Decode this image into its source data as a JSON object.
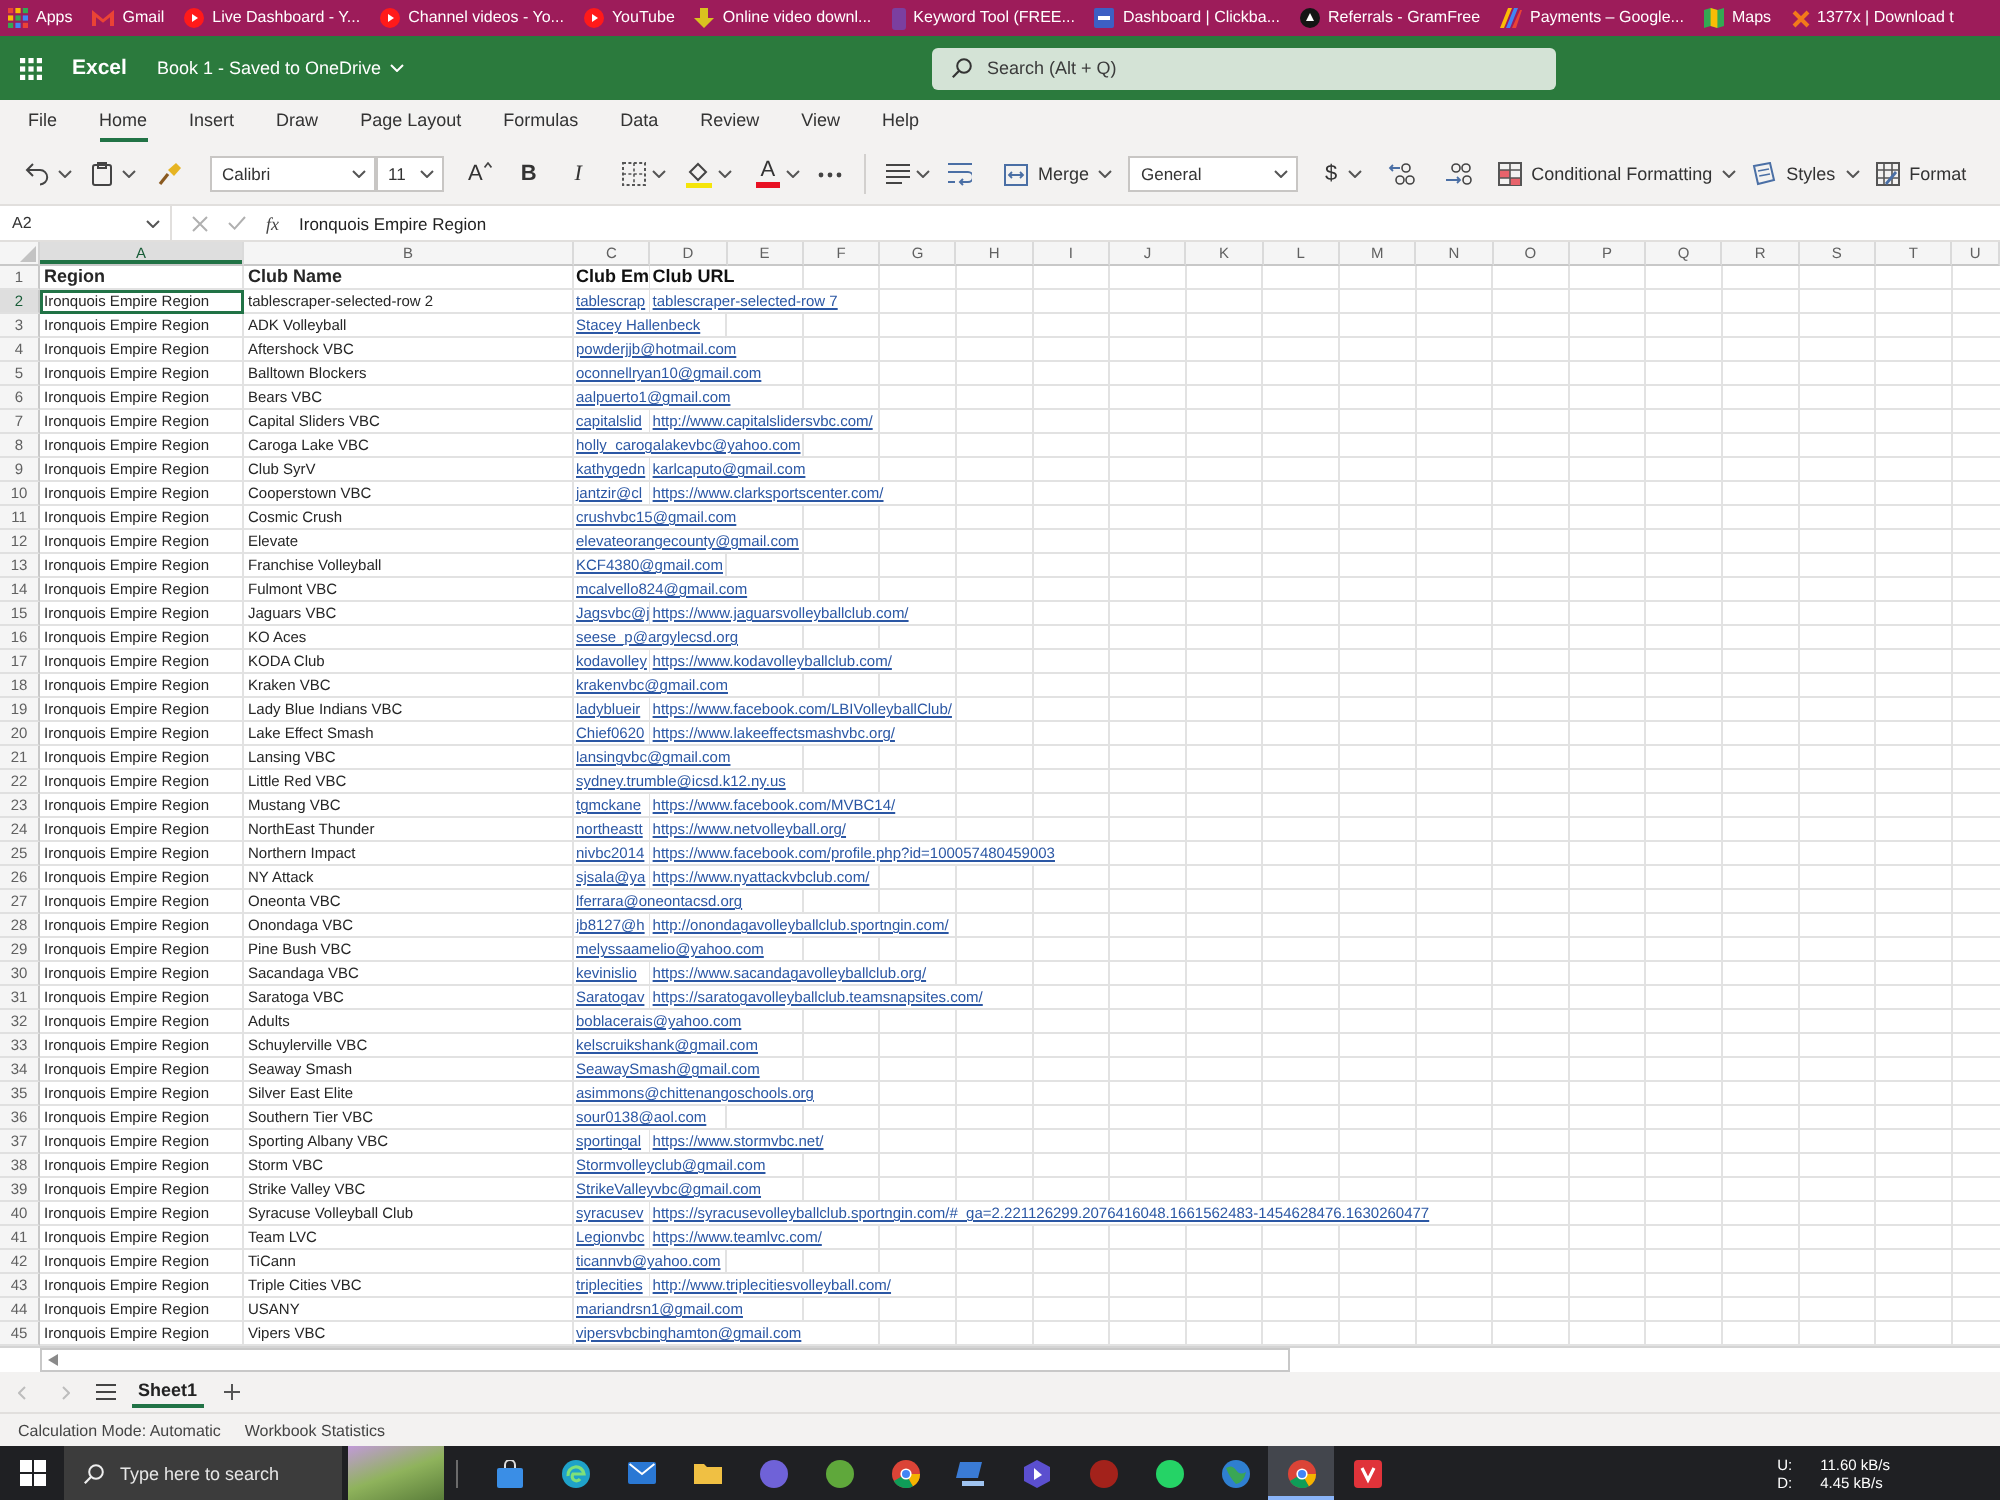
{
  "bookmarks_bar": {
    "items": [
      {
        "label": "Apps",
        "kind": "apps"
      },
      {
        "label": "Gmail",
        "kind": "mail"
      },
      {
        "label": "Live Dashboard - Y...",
        "kind": "video"
      },
      {
        "label": "Channel videos - Yo...",
        "kind": "video"
      },
      {
        "label": "YouTube",
        "kind": "video"
      },
      {
        "label": "Online video downl...",
        "kind": "download"
      },
      {
        "label": "Keyword Tool (FREE...",
        "kind": "tile"
      },
      {
        "label": "Dashboard | Clickba...",
        "kind": "square"
      },
      {
        "label": "Referrals - GramFree",
        "kind": "circle"
      },
      {
        "label": "Payments – Google...",
        "kind": "stripes"
      },
      {
        "label": "Maps",
        "kind": "map"
      },
      {
        "label": "1377x | Download t",
        "kind": "cross"
      }
    ]
  },
  "app_header": {
    "app_name": "Excel",
    "document_title": "Book 1 - Saved to OneDrive",
    "search": {
      "placeholder": "Search (Alt + Q)"
    }
  },
  "menu_tabs": [
    {
      "label": "File",
      "selected": false
    },
    {
      "label": "Home",
      "selected": true
    },
    {
      "label": "Insert",
      "selected": false
    },
    {
      "label": "Draw",
      "selected": false
    },
    {
      "label": "Page Layout",
      "selected": false
    },
    {
      "label": "Formulas",
      "selected": false
    },
    {
      "label": "Data",
      "selected": false
    },
    {
      "label": "Review",
      "selected": false
    },
    {
      "label": "View",
      "selected": false
    },
    {
      "label": "Help",
      "selected": false
    }
  ],
  "ribbon": {
    "font_name": "Calibri",
    "font_size": "11",
    "increase_font": "A",
    "bold": "B",
    "italic": "I",
    "font_color": "A",
    "merge": "Merge",
    "number_format": "General",
    "currency": "$",
    "conditional_formatting": "Conditional Formatting",
    "styles": "Styles",
    "format": "Format"
  },
  "formula_bar": {
    "name_box": "A2",
    "function_label": "fx",
    "formula": "Ironquois Empire Region"
  },
  "sheet": {
    "columns": [
      {
        "label": "A",
        "selected": true
      },
      {
        "label": "B",
        "selected": false
      },
      {
        "label": "C",
        "selected": false
      },
      {
        "label": "D",
        "selected": false
      },
      {
        "label": "E",
        "selected": false
      },
      {
        "label": "F",
        "selected": false
      },
      {
        "label": "G",
        "selected": false
      },
      {
        "label": "H",
        "selected": false
      },
      {
        "label": "I",
        "selected": false
      },
      {
        "label": "J",
        "selected": false
      },
      {
        "label": "K",
        "selected": false
      },
      {
        "label": "L",
        "selected": false
      },
      {
        "label": "M",
        "selected": false
      },
      {
        "label": "N",
        "selected": false
      },
      {
        "label": "O",
        "selected": false
      },
      {
        "label": "P",
        "selected": false
      },
      {
        "label": "Q",
        "selected": false
      },
      {
        "label": "R",
        "selected": false
      },
      {
        "label": "S",
        "selected": false
      },
      {
        "label": "T",
        "selected": false
      },
      {
        "label": "U",
        "selected": false
      }
    ],
    "rows": [
      {
        "number": "1",
        "kind": "header",
        "selected": false,
        "cells": {
          "A": "Region",
          "B": "Club Name",
          "C": "Club Em",
          "D": "Club URL"
        }
      },
      {
        "number": "2",
        "kind": "data",
        "selected": true,
        "cells": {
          "A": "Ironquois Empire Region",
          "B": "tablescraper-selected-row 2",
          "C": "tablescrap",
          "D": "tablescraper-selected-row 7"
        }
      },
      {
        "number": "3",
        "kind": "data",
        "selected": false,
        "cells": {
          "A": "Ironquois Empire Region",
          "B": "ADK Volleyball",
          "C": "Stacey Hallenbeck"
        }
      },
      {
        "number": "4",
        "kind": "data",
        "selected": false,
        "cells": {
          "A": "Ironquois Empire Region",
          "B": "Aftershock VBC",
          "C": "powderjjb@hotmail.com"
        }
      },
      {
        "number": "5",
        "kind": "data",
        "selected": false,
        "cells": {
          "A": "Ironquois Empire Region",
          "B": "Balltown Blockers",
          "C": "oconnellryan10@gmail.com"
        }
      },
      {
        "number": "6",
        "kind": "data",
        "selected": false,
        "cells": {
          "A": "Ironquois Empire Region",
          "B": "Bears VBC",
          "C": "aalpuerto1@gmail.com"
        }
      },
      {
        "number": "7",
        "kind": "data",
        "selected": false,
        "cells": {
          "A": "Ironquois Empire Region",
          "B": "Capital Sliders VBC",
          "C": "capitalslid",
          "D": "http://www.capitalslidersvbc.com/"
        }
      },
      {
        "number": "8",
        "kind": "data",
        "selected": false,
        "cells": {
          "A": "Ironquois Empire Region",
          "B": "Caroga Lake VBC",
          "C": "holly_carogalakevbc@yahoo.com"
        }
      },
      {
        "number": "9",
        "kind": "data",
        "selected": false,
        "cells": {
          "A": "Ironquois Empire Region",
          "B": "Club SyrV",
          "C": "kathygedn",
          "D": "karlcaputo@gmail.com"
        }
      },
      {
        "number": "10",
        "kind": "data",
        "selected": false,
        "cells": {
          "A": "Ironquois Empire Region",
          "B": "Cooperstown VBC",
          "C": "jantzir@cl",
          "D": "https://www.clarksportscenter.com/"
        }
      },
      {
        "number": "11",
        "kind": "data",
        "selected": false,
        "cells": {
          "A": "Ironquois Empire Region",
          "B": "Cosmic Crush",
          "C": "crushvbc15@gmail.com"
        }
      },
      {
        "number": "12",
        "kind": "data",
        "selected": false,
        "cells": {
          "A": "Ironquois Empire Region",
          "B": "Elevate",
          "C": "elevateorangecounty@gmail.com"
        }
      },
      {
        "number": "13",
        "kind": "data",
        "selected": false,
        "cells": {
          "A": "Ironquois Empire Region",
          "B": "Franchise Volleyball",
          "C": "KCF4380@gmail.com"
        }
      },
      {
        "number": "14",
        "kind": "data",
        "selected": false,
        "cells": {
          "A": "Ironquois Empire Region",
          "B": "Fulmont VBC",
          "C": "mcalvello824@gmail.com"
        }
      },
      {
        "number": "15",
        "kind": "data",
        "selected": false,
        "cells": {
          "A": "Ironquois Empire Region",
          "B": "Jaguars VBC",
          "C": "Jagsvbc@j",
          "D": "https://www.jaguarsvolleyballclub.com/"
        }
      },
      {
        "number": "16",
        "kind": "data",
        "selected": false,
        "cells": {
          "A": "Ironquois Empire Region",
          "B": "KO Aces",
          "C": "seese_p@argylecsd.org"
        }
      },
      {
        "number": "17",
        "kind": "data",
        "selected": false,
        "cells": {
          "A": "Ironquois Empire Region",
          "B": "KODA Club",
          "C": "kodavolley",
          "D": "https://www.kodavolleyballclub.com/"
        }
      },
      {
        "number": "18",
        "kind": "data",
        "selected": false,
        "cells": {
          "A": "Ironquois Empire Region",
          "B": "Kraken VBC",
          "C": "krakenvbc@gmail.com"
        }
      },
      {
        "number": "19",
        "kind": "data",
        "selected": false,
        "cells": {
          "A": "Ironquois Empire Region",
          "B": "Lady Blue Indians VBC",
          "C": "ladyblueir",
          "D": "https://www.facebook.com/LBIVolleyballClub/"
        }
      },
      {
        "number": "20",
        "kind": "data",
        "selected": false,
        "cells": {
          "A": "Ironquois Empire Region",
          "B": "Lake Effect Smash",
          "C": "Chief0620",
          "D": "https://www.lakeeffectsmashvbc.org/"
        }
      },
      {
        "number": "21",
        "kind": "data",
        "selected": false,
        "cells": {
          "A": "Ironquois Empire Region",
          "B": "Lansing VBC",
          "C": "lansingvbc@gmail.com"
        }
      },
      {
        "number": "22",
        "kind": "data",
        "selected": false,
        "cells": {
          "A": "Ironquois Empire Region",
          "B": "Little Red VBC",
          "C": "sydney.trumble@icsd.k12.ny.us"
        }
      },
      {
        "number": "23",
        "kind": "data",
        "selected": false,
        "cells": {
          "A": "Ironquois Empire Region",
          "B": "Mustang VBC",
          "C": "tgmckane",
          "D": "https://www.facebook.com/MVBC14/"
        }
      },
      {
        "number": "24",
        "kind": "data",
        "selected": false,
        "cells": {
          "A": "Ironquois Empire Region",
          "B": "NorthEast Thunder",
          "C": "northeastt",
          "D": "https://www.netvolleyball.org/"
        }
      },
      {
        "number": "25",
        "kind": "data",
        "selected": false,
        "cells": {
          "A": "Ironquois Empire Region",
          "B": "Northern Impact",
          "C": "nivbc2014",
          "D": "https://www.facebook.com/profile.php?id=100057480459003"
        }
      },
      {
        "number": "26",
        "kind": "data",
        "selected": false,
        "cells": {
          "A": "Ironquois Empire Region",
          "B": "NY Attack",
          "C": "sjsala@ya",
          "D": "https://www.nyattackvbclub.com/"
        }
      },
      {
        "number": "27",
        "kind": "data",
        "selected": false,
        "cells": {
          "A": "Ironquois Empire Region",
          "B": "Oneonta VBC",
          "C": "lferrara@oneontacsd.org"
        }
      },
      {
        "number": "28",
        "kind": "data",
        "selected": false,
        "cells": {
          "A": "Ironquois Empire Region",
          "B": "Onondaga VBC",
          "C": "jb8127@h",
          "D": "http://onondagavolleyballclub.sportngin.com/"
        }
      },
      {
        "number": "29",
        "kind": "data",
        "selected": false,
        "cells": {
          "A": "Ironquois Empire Region",
          "B": "Pine Bush VBC",
          "C": "melyssaamelio@yahoo.com"
        }
      },
      {
        "number": "30",
        "kind": "data",
        "selected": false,
        "cells": {
          "A": "Ironquois Empire Region",
          "B": "Sacandaga VBC",
          "C": "kevinislio",
          "D": "https://www.sacandagavolleyballclub.org/"
        }
      },
      {
        "number": "31",
        "kind": "data",
        "selected": false,
        "cells": {
          "A": "Ironquois Empire Region",
          "B": "Saratoga VBC",
          "C": "Saratogav",
          "D": "https://saratogavolleyballclub.teamsnapsites.com/"
        }
      },
      {
        "number": "32",
        "kind": "data",
        "selected": false,
        "cells": {
          "A": "Ironquois Empire Region",
          "B": "Adults",
          "C": "boblacerais@yahoo.com"
        }
      },
      {
        "number": "33",
        "kind": "data",
        "selected": false,
        "cells": {
          "A": "Ironquois Empire Region",
          "B": "Schuylerville VBC",
          "C": "kelscruikshank@gmail.com"
        }
      },
      {
        "number": "34",
        "kind": "data",
        "selected": false,
        "cells": {
          "A": "Ironquois Empire Region",
          "B": "Seaway Smash",
          "C": "SeawaySmash@gmail.com"
        }
      },
      {
        "number": "35",
        "kind": "data",
        "selected": false,
        "cells": {
          "A": "Ironquois Empire Region",
          "B": "Silver East Elite",
          "C": "asimmons@chittenangoschools.org"
        }
      },
      {
        "number": "36",
        "kind": "data",
        "selected": false,
        "cells": {
          "A": "Ironquois Empire Region",
          "B": "Southern Tier VBC",
          "C": "sour0138@aol.com"
        }
      },
      {
        "number": "37",
        "kind": "data",
        "selected": false,
        "cells": {
          "A": "Ironquois Empire Region",
          "B": "Sporting Albany VBC",
          "C": "sportingal",
          "D": "https://www.stormvbc.net/"
        }
      },
      {
        "number": "38",
        "kind": "data",
        "selected": false,
        "cells": {
          "A": "Ironquois Empire Region",
          "B": "Storm VBC",
          "C": "Stormvolleyclub@gmail.com"
        }
      },
      {
        "number": "39",
        "kind": "data",
        "selected": false,
        "cells": {
          "A": "Ironquois Empire Region",
          "B": "Strike Valley VBC",
          "C": "StrikeValleyvbc@gmail.com"
        }
      },
      {
        "number": "40",
        "kind": "data",
        "selected": false,
        "cells": {
          "A": "Ironquois Empire Region",
          "B": "Syracuse Volleyball Club",
          "C": "syracusev",
          "D": "https://syracusevolleyballclub.sportngin.com/#_ga=2.221126299.2076416048.1661562483-1454628476.1630260477"
        }
      },
      {
        "number": "41",
        "kind": "data",
        "selected": false,
        "cells": {
          "A": "Ironquois Empire Region",
          "B": "Team LVC",
          "C": "Legionvbc",
          "D": "https://www.teamlvc.com/"
        }
      },
      {
        "number": "42",
        "kind": "data",
        "selected": false,
        "cells": {
          "A": "Ironquois Empire Region",
          "B": "TiCann",
          "C": "ticannvb@yahoo.com"
        }
      },
      {
        "number": "43",
        "kind": "data",
        "selected": false,
        "cells": {
          "A": "Ironquois Empire Region",
          "B": "Triple Cities VBC",
          "C": "triplecities",
          "D": "http://www.triplecitiesvolleyball.com/"
        }
      },
      {
        "number": "44",
        "kind": "data",
        "selected": false,
        "cells": {
          "A": "Ironquois Empire Region",
          "B": "USANY",
          "C": "mariandrsn1@gmail.com"
        }
      },
      {
        "number": "45",
        "kind": "data",
        "selected": false,
        "cells": {
          "A": "Ironquois Empire Region",
          "B": "Vipers VBC",
          "C": "vipersvbcbinghamton@gmail.com"
        }
      }
    ]
  },
  "sheet_tabs": [
    {
      "label": "Sheet1",
      "selected": true
    }
  ],
  "status_bar": {
    "items": [
      "Calculation Mode: Automatic",
      "Workbook Statistics"
    ]
  },
  "taskbar": {
    "search": {
      "placeholder": "Type here to search"
    },
    "apps": [
      {
        "kind": "bag",
        "color": "#3a8ee6",
        "selected": false
      },
      {
        "kind": "swirl",
        "color": "#1fa2c9",
        "selected": false
      },
      {
        "kind": "envelope",
        "color": "#2a78d4",
        "selected": false
      },
      {
        "kind": "folder",
        "color": "#f0c043",
        "selected": false
      },
      {
        "kind": "disc",
        "color": "#6f62d8",
        "selected": false
      },
      {
        "kind": "disc",
        "color": "#5fa83b",
        "selected": false
      },
      {
        "kind": "browser",
        "color": "#db4437",
        "selected": false
      },
      {
        "kind": "laptop",
        "color": "#3a7bd5",
        "selected": false
      },
      {
        "kind": "hexagon",
        "color": "#5b4fcf",
        "selected": false
      },
      {
        "kind": "disc",
        "color": "#a3221b",
        "selected": false
      },
      {
        "kind": "disc",
        "color": "#25d366",
        "selected": false
      },
      {
        "kind": "globe",
        "color": "#3aa655",
        "selected": false
      },
      {
        "kind": "browser",
        "color": "#db4437",
        "selected": true
      },
      {
        "kind": "square",
        "color": "#e0333a",
        "selected": false
      }
    ],
    "network": {
      "upload_label": "U:",
      "upload": "11.60 kB/s",
      "download_label": "D:",
      "download": "4.45 kB/s"
    }
  }
}
